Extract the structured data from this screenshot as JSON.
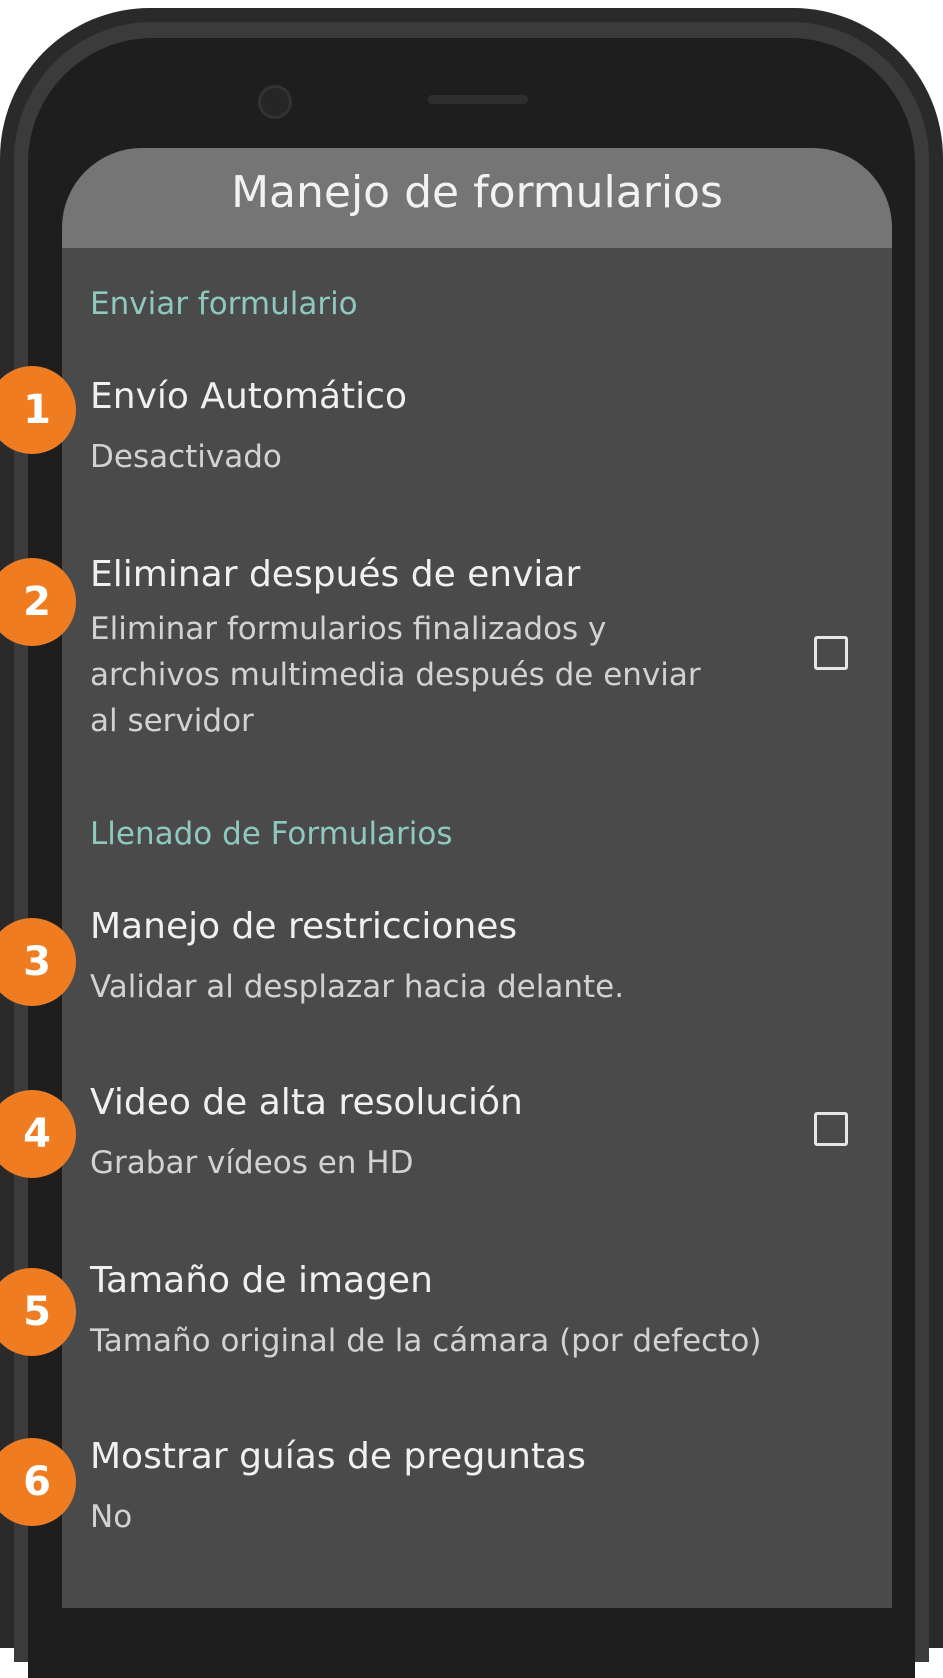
{
  "app_bar": {
    "title": "Manejo de formularios"
  },
  "sections": [
    {
      "header": "Enviar formulario"
    },
    {
      "header": "Llenado de Formularios"
    }
  ],
  "items": [
    {
      "badge": "1",
      "title": "Envío Automático",
      "summary": "Desactivado",
      "checkbox": null
    },
    {
      "badge": "2",
      "title": "Eliminar después de enviar",
      "summary_lines": [
        "Eliminar formularios finalizados y",
        "archivos multimedia después de enviar",
        "al servidor"
      ],
      "checkbox": false
    },
    {
      "badge": "3",
      "title": "Manejo de restricciones",
      "summary": "Validar al desplazar hacia delante.",
      "checkbox": null
    },
    {
      "badge": "4",
      "title": "Video de alta resolución",
      "summary": "Grabar vídeos en HD",
      "checkbox": false
    },
    {
      "badge": "5",
      "title": "Tamaño de imagen",
      "summary": "Tamaño original de la cámara (por defecto)",
      "checkbox": null
    },
    {
      "badge": "6",
      "title": "Mostrar guías de preguntas",
      "summary": "No",
      "checkbox": null
    }
  ],
  "colors": {
    "accent_header": "#8ec8bf",
    "badge": "#f07c22",
    "screen_bg": "#4a4a4a",
    "app_bar_bg": "#757575"
  }
}
